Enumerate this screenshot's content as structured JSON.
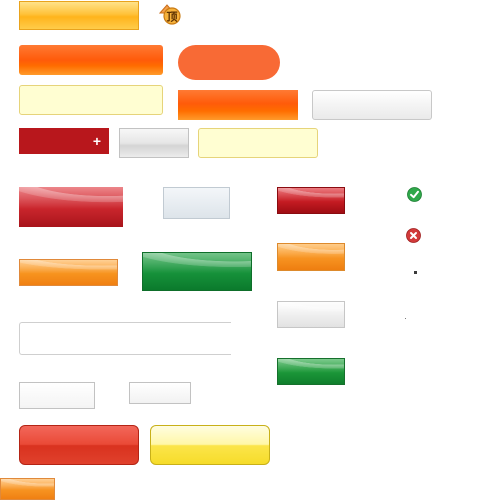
{
  "page": {
    "background": "#ffffff"
  },
  "sprites": {
    "red_plus_glyph": "+",
    "top_icon_glyph": "顶",
    "icons": [
      "top-arrow-icon",
      "check-icon",
      "cross-icon"
    ],
    "colors": {
      "orange": "#ff6d00",
      "red": "#c41b22",
      "green": "#16913a",
      "yellow": "#ffc23a",
      "pale_yellow": "#fffed2",
      "gray": "#e6e6e6"
    }
  }
}
